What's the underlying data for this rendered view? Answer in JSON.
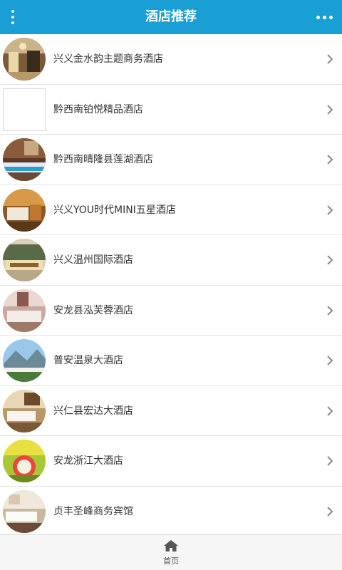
{
  "header": {
    "title": "酒店推荐",
    "menu_icon": "vertical-dots-icon",
    "more_icon": "horizontal-dots-icon",
    "background": "#1a9fd5"
  },
  "hotels": [
    {
      "name": "兴义金水韵主题商务酒店",
      "thumb": "hotel-lobby-photo"
    },
    {
      "name": "黔西南铂悦精品酒店",
      "thumb": "empty"
    },
    {
      "name": "黔西南晴隆县莲湖酒店",
      "thumb": "hotel-room-photo"
    },
    {
      "name": "兴义YOU时代MINI五星酒店",
      "thumb": "hotel-room-photo"
    },
    {
      "name": "兴义温州国际酒店",
      "thumb": "hotel-exterior-photo"
    },
    {
      "name": "安龙县泓芙蓉酒店",
      "thumb": "hotel-room-photo"
    },
    {
      "name": "普安温泉大酒店",
      "thumb": "landscape-photo"
    },
    {
      "name": "兴仁县宏达大酒店",
      "thumb": "hotel-room-photo"
    },
    {
      "name": "安龙浙江大酒店",
      "thumb": "hotel-restaurant-photo"
    },
    {
      "name": "贞丰圣峰商务宾馆",
      "thumb": "hotel-room-photo"
    }
  ],
  "bottom_nav": {
    "home_label": "首页",
    "home_icon": "home-icon"
  }
}
